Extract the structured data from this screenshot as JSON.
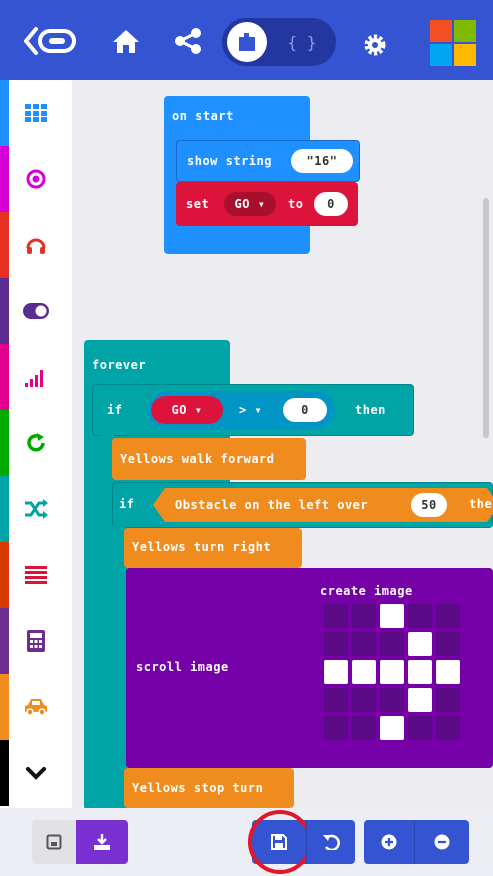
{
  "colors": {
    "header": "#3454d1",
    "on_start": "#1e90ff",
    "variables": "#dc143c",
    "loops": "#00a4a6",
    "logic": "#00a4a6",
    "robot": "#f08c1e",
    "images": "#7600a8"
  },
  "header": {
    "back_icon": "back-arrow-icon",
    "home_icon": "home-icon",
    "share_icon": "share-icon",
    "blocks_icon": "blocks-icon",
    "js_label": "{ }",
    "settings_icon": "gear-icon",
    "logo": "microsoft-logo"
  },
  "toolbox": [
    {
      "icon": "grid-icon",
      "color": "#1e90ff"
    },
    {
      "icon": "target-icon",
      "color": "#d400d4"
    },
    {
      "icon": "headphones-icon",
      "color": "#e63022"
    },
    {
      "icon": "toggle-icon",
      "color": "#5c2d91"
    },
    {
      "icon": "signal-icon",
      "color": "#e3008c"
    },
    {
      "icon": "refresh-icon",
      "color": "#00aa00"
    },
    {
      "icon": "shuffle-icon",
      "color": "#00a4a6"
    },
    {
      "icon": "list-icon",
      "color": "#d83b01"
    },
    {
      "icon": "calculator-icon",
      "color": "#6b2d91"
    },
    {
      "icon": "car-icon",
      "color": "#f08c1e"
    },
    {
      "icon": "chevron-down-icon",
      "color": "#000000"
    }
  ],
  "blocks": {
    "on_start": "on start",
    "show_string": "show string",
    "show_string_value": "\"16\"",
    "set": "set",
    "set_var": "GO ▾",
    "set_to": "to",
    "set_value": "0",
    "forever": "forever",
    "if1": "if",
    "if1_var": "GO ▾",
    "if1_op": "> ▾",
    "if1_value": "0",
    "then1": "then",
    "walk_forward": "Yellows walk forward",
    "if2": "if",
    "obstacle": "Obstacle on the left over",
    "obstacle_value": "50",
    "then2": "the",
    "turn_right": "Yellows turn right",
    "scroll_image": "scroll image",
    "create_image": "create image",
    "stop_turn": "Yellows stop turn"
  },
  "image_grid": [
    [
      0,
      0,
      1,
      0,
      0
    ],
    [
      0,
      0,
      0,
      1,
      0
    ],
    [
      1,
      1,
      1,
      1,
      1
    ],
    [
      0,
      0,
      0,
      1,
      0
    ],
    [
      0,
      0,
      1,
      0,
      0
    ]
  ],
  "bottom": {
    "screenshot_icon": "screenshot-icon",
    "download_icon": "download-icon",
    "save_icon": "save-icon",
    "undo_icon": "undo-icon",
    "zoom_in_icon": "zoom-in-icon",
    "zoom_out_icon": "zoom-out-icon"
  }
}
